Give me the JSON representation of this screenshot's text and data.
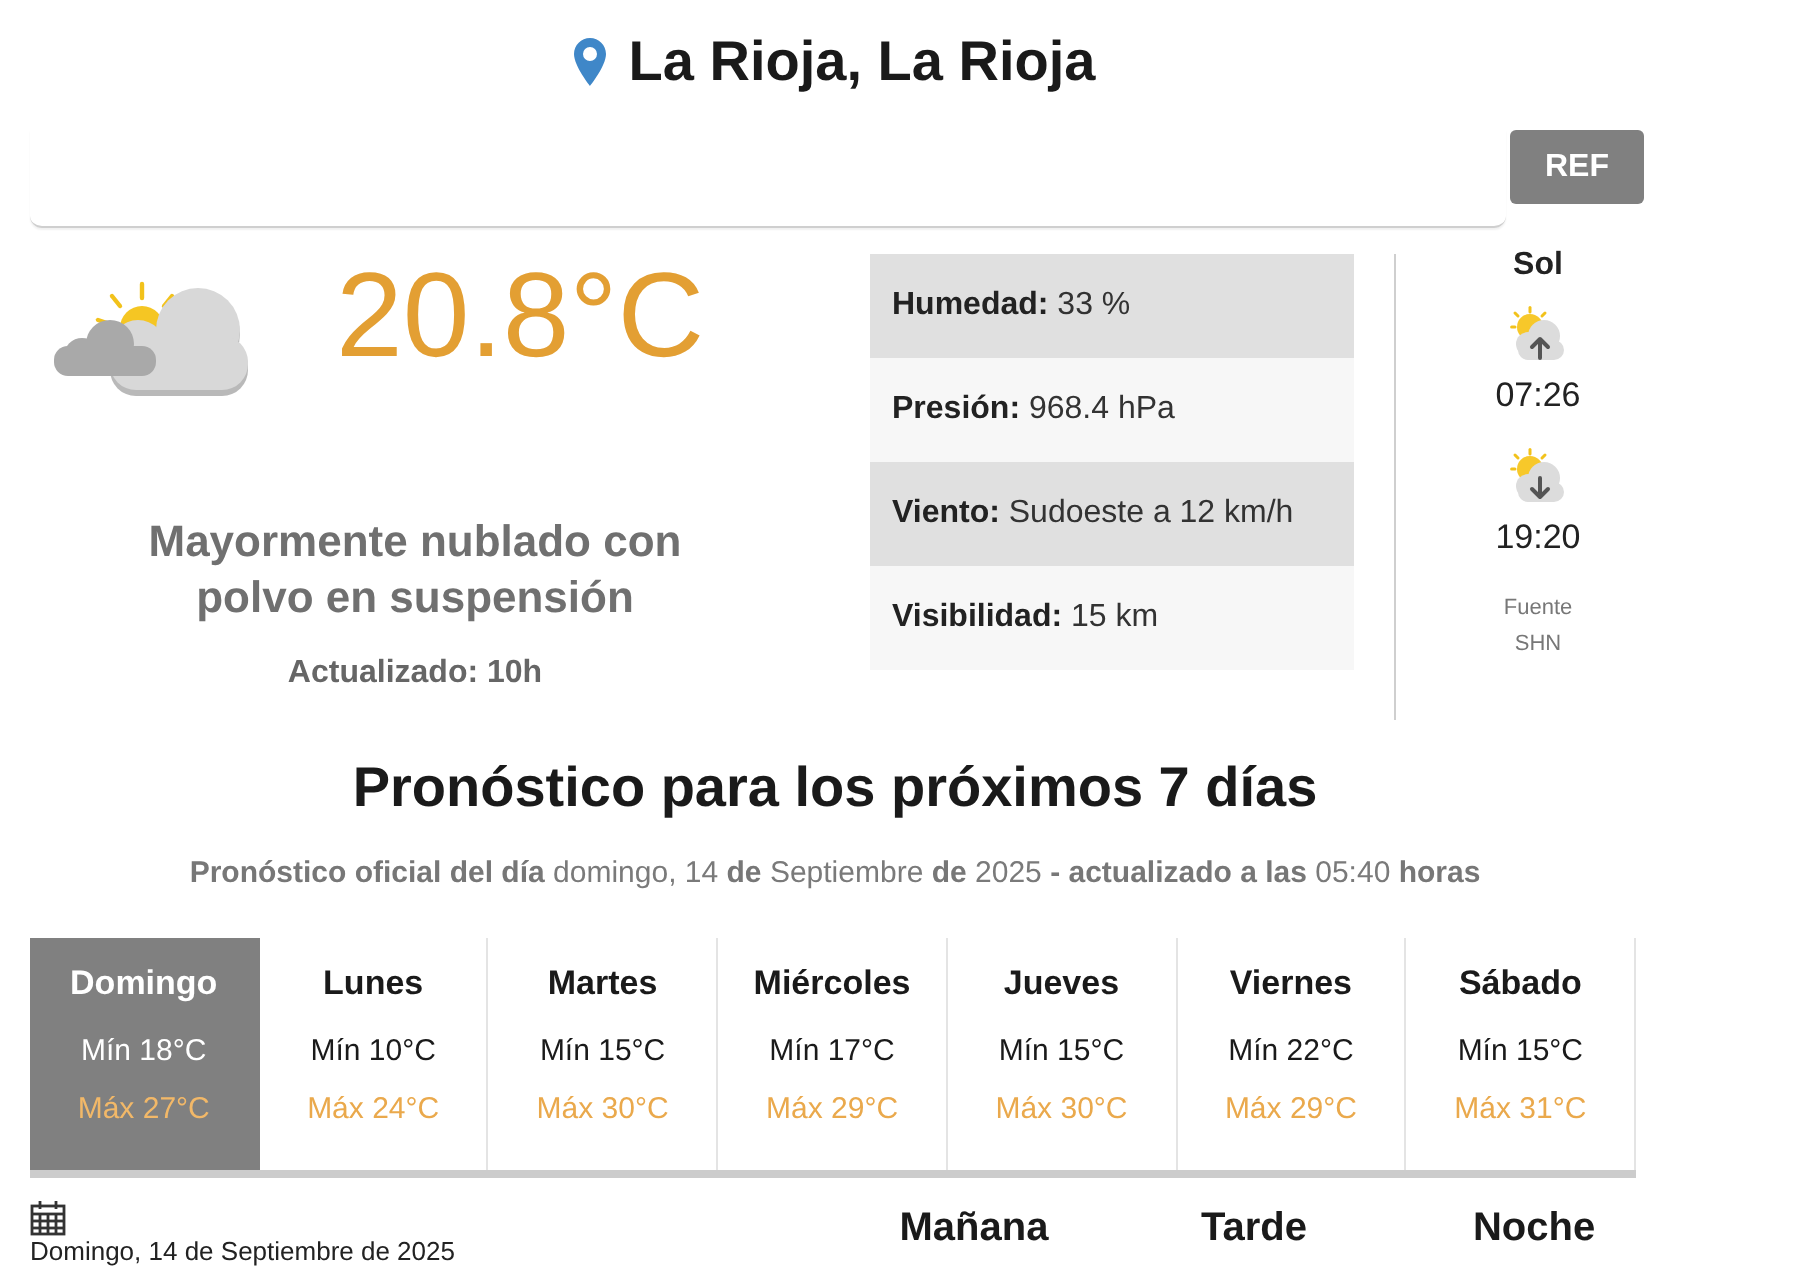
{
  "header": {
    "location": "La Rioja, La Rioja",
    "ref_button": "REF"
  },
  "current": {
    "temperature": "20.8°C",
    "description": "Mayormente nublado con polvo en suspensión",
    "updated": "Actualizado: 10h"
  },
  "details": [
    {
      "label": "Humedad:",
      "value": "33 %"
    },
    {
      "label": "Presión:",
      "value": "968.4 hPa"
    },
    {
      "label": "Viento:",
      "value": "Sudoeste a 12 km/h"
    },
    {
      "label": "Visibilidad:",
      "value": "15 km"
    }
  ],
  "sun": {
    "title": "Sol",
    "events": [
      {
        "kind": "sunrise",
        "time": "07:26"
      },
      {
        "kind": "sunset",
        "time": "19:20"
      }
    ],
    "source_label": "Fuente",
    "source_name": "SHN"
  },
  "forecast": {
    "title": "Pronóstico para los próximos 7 días",
    "subtitle": "**Pronóstico oficial del día** domingo, 14 **de** Septiembre **de** 2025 **- actualizado a las** 05:40 **horas**",
    "days": [
      {
        "name": "Domingo",
        "min": "Mín 18°C",
        "max": "Máx 27°C",
        "selected": true
      },
      {
        "name": "Lunes",
        "min": "Mín 10°C",
        "max": "Máx 24°C",
        "selected": false
      },
      {
        "name": "Martes",
        "min": "Mín 15°C",
        "max": "Máx 30°C",
        "selected": false
      },
      {
        "name": "Miércoles",
        "min": "Mín 17°C",
        "max": "Máx 29°C",
        "selected": false
      },
      {
        "name": "Jueves",
        "min": "Mín 15°C",
        "max": "Máx 30°C",
        "selected": false
      },
      {
        "name": "Viernes",
        "min": "Mín 22°C",
        "max": "Máx 29°C",
        "selected": false
      },
      {
        "name": "Sábado",
        "min": "Mín 15°C",
        "max": "Máx 31°C",
        "selected": false
      }
    ]
  },
  "day_detail": {
    "date": "Domingo, 14 de Septiembre de 2025",
    "periods": [
      "Mañana",
      "Tarde",
      "Noche"
    ]
  }
}
